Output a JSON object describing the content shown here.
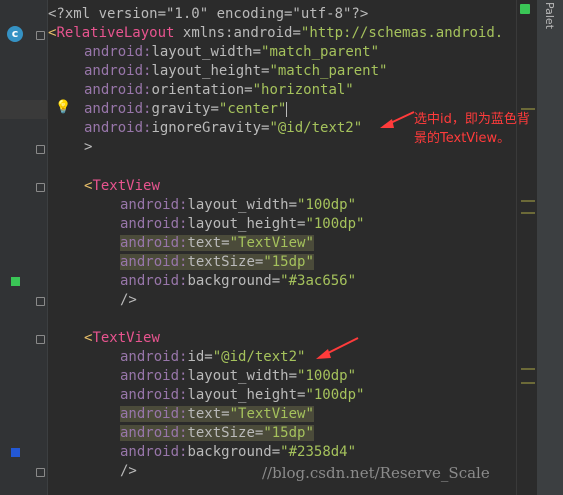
{
  "panel": {
    "palette_label": "Palet",
    "class_icon": "c"
  },
  "colors": {
    "swatch_text1": "#3ac656",
    "swatch_text2": "#2358d4",
    "annotation": "#ff3b3b"
  },
  "icons": {
    "class_icon": "c-icon",
    "bulb": "lightbulb-icon",
    "fold_marker": "fold-icon",
    "arrow": "red-arrow-icon"
  },
  "code": {
    "l1": "<?xml version=\"1.0\" encoding=\"utf-8\"?>",
    "l2_tag": "RelativeLayout",
    "l2_attr": "xmlns:android",
    "l2_val": "\"http://schemas.android.",
    "l3_attr": "layout_width",
    "l3_val": "\"match_parent\"",
    "l4_attr": "layout_height",
    "l4_val": "\"match_parent\"",
    "l5_attr": "orientation",
    "l5_val": "\"horizontal\"",
    "l6_attr": "gravity",
    "l6_val": "\"center\"",
    "l7_attr": "ignoreGravity",
    "l7_val": "\"@id/text2\"",
    "l8": ">",
    "tv1_tag": "TextView",
    "tv1_w": "layout_width",
    "tv1_w_val": "\"100dp\"",
    "tv1_h": "layout_height",
    "tv1_h_val": "\"100dp\"",
    "tv1_text": "text",
    "tv1_text_val": "\"TextView\"",
    "tv1_size": "textSize",
    "tv1_size_val": "\"15dp\"",
    "tv1_bg": "background",
    "tv1_bg_val": "\"#3ac656\"",
    "tv1_close": "/>",
    "tv2_tag": "TextView",
    "tv2_id": "id",
    "tv2_id_val": "\"@id/text2\"",
    "tv2_w": "layout_width",
    "tv2_w_val": "\"100dp\"",
    "tv2_h": "layout_height",
    "tv2_h_val": "\"100dp\"",
    "tv2_text": "text",
    "tv2_text_val": "\"TextView\"",
    "tv2_size": "textSize",
    "tv2_size_val": "\"15dp\"",
    "tv2_bg": "background",
    "tv2_bg_val": "\"#2358d4\"",
    "tv2_close": "/>",
    "ns": "android:",
    "eq": "=",
    "lt": "<"
  },
  "annotation": {
    "line1": "选中id，即为蓝色背",
    "line2": "景的TextView。"
  },
  "watermark": "//blog.csdn.net/Reserve_Scale"
}
